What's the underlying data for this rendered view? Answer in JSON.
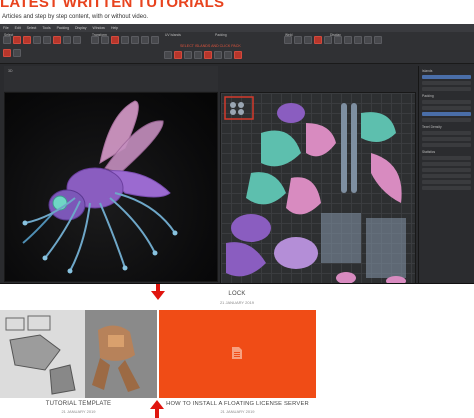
{
  "header": {
    "title": "LATEST WRITTEN TUTORIALS",
    "subtitle": "Articles and step by step content, with or without video."
  },
  "app_screenshot": {
    "menu_items": [
      "File",
      "Edit",
      "Select",
      "Tools",
      "Packing",
      "Display",
      "Window",
      "Help"
    ],
    "tool_groups": [
      "Select",
      "Transform",
      "UV Islands",
      "Packing",
      "Weld",
      "Display"
    ],
    "highlight_hint": "SELECT ISLANDS AND CLICK PACK",
    "viewport_3d_label": "3D",
    "viewport_uv_label": "UV",
    "right_panel_titles": [
      "Islands",
      "Packing",
      "Texel Density",
      "Statistics"
    ],
    "accent_color": "#d43a2c"
  },
  "featured": {
    "title": "LOCK",
    "date": "21 JANUARY 2019"
  },
  "cards": [
    {
      "title": "TUTORIAL TEMPLATE",
      "date": "21 JANUARY 2019",
      "color": "#bdbdbd"
    },
    {
      "title": "HOW TO INSTALL A FLOATING LICENSE SERVER",
      "date": "21 JANUARY 2019",
      "color": "#f04c16"
    }
  ],
  "colors": {
    "brand": "#e8431e",
    "arrow": "#e0150f",
    "uv_purple": "#8a5dc0",
    "uv_teal": "#5dbfae",
    "uv_pink": "#d88bc0",
    "uv_grey": "#7e8fa1"
  },
  "icons": {
    "card_icon": "document-icon",
    "arrow_icon": "arrow-down-icon"
  }
}
